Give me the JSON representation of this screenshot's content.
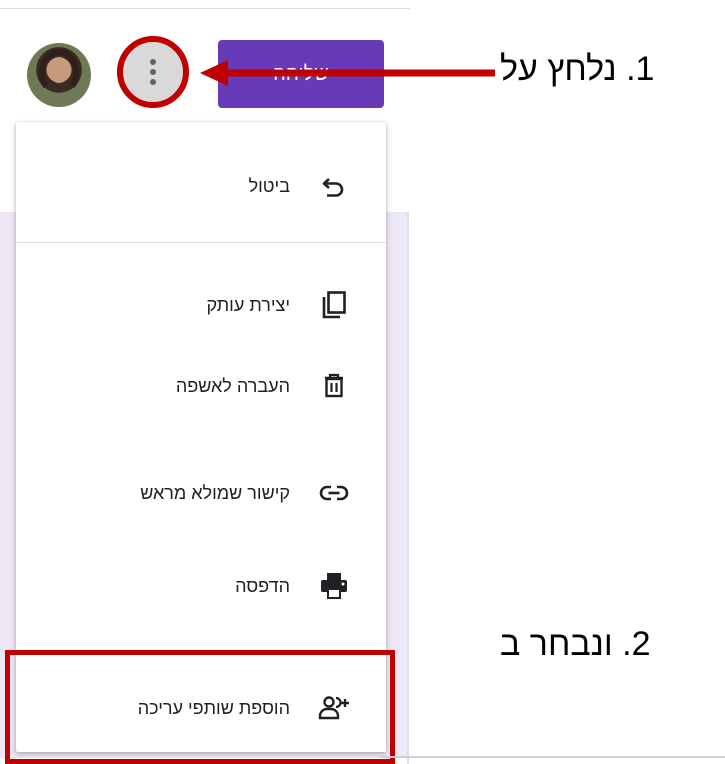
{
  "header": {
    "send_button_label": "שליחה",
    "more_icon": "more-vert-icon",
    "avatar": "user-avatar"
  },
  "menu": {
    "items": [
      {
        "label": "ביטול",
        "icon": "undo-icon"
      },
      {
        "label": "יצירת עותק",
        "icon": "copy-icon"
      },
      {
        "label": "העברה לאשפה",
        "icon": "trash-icon"
      },
      {
        "label": "קישור שמולא מראש",
        "icon": "link-icon"
      },
      {
        "label": "הדפסה",
        "icon": "print-icon"
      },
      {
        "label": "הוספת שותפי עריכה",
        "icon": "add-collaborators-icon"
      }
    ]
  },
  "annotations": {
    "step1": "1.  נלחץ על",
    "step2": "2.  ונבחר ב",
    "color": "#c00000"
  },
  "colors": {
    "accent": "#673ab7",
    "background_tint": "#ede7f6"
  }
}
